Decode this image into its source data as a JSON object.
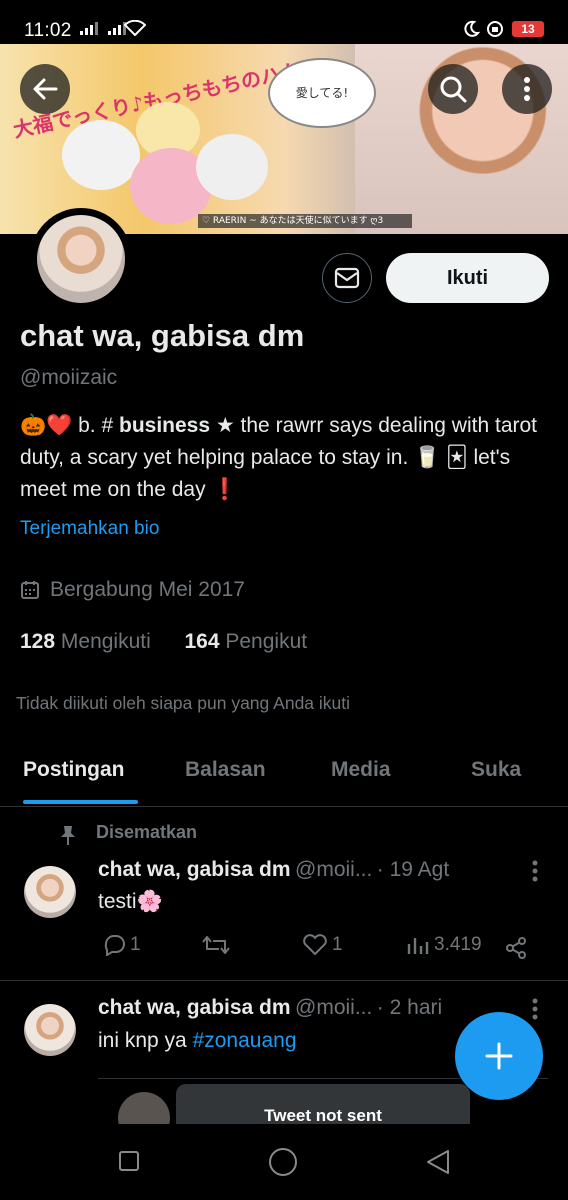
{
  "status_bar": {
    "time": "11:02",
    "signal_1": "4G",
    "battery": "13"
  },
  "banner": {
    "title": "大福でっくり♪もっちもちのハム",
    "bubble_text": "愛してる!",
    "caption": "♡ RAERIN ~ あなたは天使に似ています ღ3"
  },
  "profile": {
    "display_name": "chat wa, gabisa dm",
    "handle": "@moiizaic",
    "bio_emoji_prefix": "🎃❤️",
    "bio_pre": " b. # ",
    "bio_bold": "business",
    "bio_post": " ★ the rawrr says dealing with tarot duty, a scary yet helping palace to stay in. 🥛 🃏 let's meet me on the day ❗",
    "translate_label": "Terjemahkan bio",
    "joined": "Bergabung Mei 2017",
    "following_count": "128",
    "following_label": "Mengikuti",
    "followers_count": "164",
    "followers_label": "Pengikut",
    "not_followed_text": "Tidak diikuti oleh siapa pun yang Anda ikuti",
    "follow_button": "Ikuti"
  },
  "tabs": [
    {
      "label": "Postingan",
      "active": true
    },
    {
      "label": "Balasan",
      "active": false
    },
    {
      "label": "Media",
      "active": false
    },
    {
      "label": "Suka",
      "active": false
    }
  ],
  "posts": [
    {
      "pinned_label": "Disematkan",
      "name": "chat wa, gabisa dm",
      "handle": "@moii...",
      "time": "· 19 Agt",
      "text": "testi🌸",
      "replies": "1",
      "likes": "1",
      "views": "3.419"
    },
    {
      "name": "chat wa, gabisa dm",
      "handle": "@moii...",
      "time": "· 2 hari",
      "text_plain": "ini knp ya ",
      "hashtag": "#zonauang"
    }
  ],
  "toast": "Tweet not sent",
  "colors": {
    "accent": "#1d9bf0",
    "muted": "#71767b",
    "background": "#000000"
  }
}
